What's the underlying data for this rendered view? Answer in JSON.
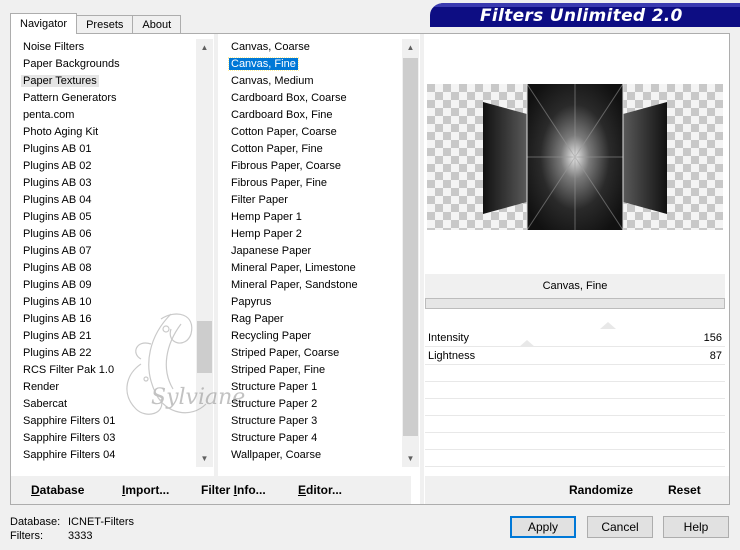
{
  "tabs": [
    "Navigator",
    "Presets",
    "About"
  ],
  "banner_title": "Filters Unlimited 2.0",
  "categories": [
    "Noise Filters",
    "Paper Backgrounds",
    "Paper Textures",
    "Pattern Generators",
    "penta.com",
    "Photo Aging Kit",
    "Plugins AB 01",
    "Plugins AB 02",
    "Plugins AB 03",
    "Plugins AB 04",
    "Plugins AB 05",
    "Plugins AB 06",
    "Plugins AB 07",
    "Plugins AB 08",
    "Plugins AB 09",
    "Plugins AB 10",
    "Plugins AB 16",
    "Plugins AB 21",
    "Plugins AB 22",
    "RCS Filter Pak 1.0",
    "Render",
    "Sabercat",
    "Sapphire Filters 01",
    "Sapphire Filters 03",
    "Sapphire Filters 04"
  ],
  "categories_selected_index": 2,
  "filters": [
    "Canvas, Coarse",
    "Canvas, Fine",
    "Canvas, Medium",
    "Cardboard Box, Coarse",
    "Cardboard Box, Fine",
    "Cotton Paper, Coarse",
    "Cotton Paper, Fine",
    "Fibrous Paper, Coarse",
    "Fibrous Paper, Fine",
    "Filter Paper",
    "Hemp Paper 1",
    "Hemp Paper 2",
    "Japanese Paper",
    "Mineral Paper, Limestone",
    "Mineral Paper, Sandstone",
    "Papyrus",
    "Rag Paper",
    "Recycling Paper",
    "Striped Paper, Coarse",
    "Striped Paper, Fine",
    "Structure Paper 1",
    "Structure Paper 2",
    "Structure Paper 3",
    "Structure Paper 4",
    "Wallpaper, Coarse"
  ],
  "filters_selected_index": 1,
  "current_filter": "Canvas, Fine",
  "parameters": [
    {
      "label": "Intensity",
      "value": "156",
      "fraction": 0.61
    },
    {
      "label": "Lightness",
      "value": "87",
      "fraction": 0.34
    }
  ],
  "bottom_buttons": {
    "database": {
      "u": "D",
      "rest": "atabase"
    },
    "import": {
      "u": "I",
      "rest": "mport..."
    },
    "filter_info": {
      "pre": "Filter ",
      "u": "I",
      "rest": "nfo..."
    },
    "editor": {
      "u": "E",
      "rest": "ditor..."
    },
    "randomize": "Randomize",
    "reset": "Reset"
  },
  "footer": {
    "database_label": "Database:",
    "database_value": "ICNET-Filters",
    "filters_label": "Filters:",
    "filters_value": "3333"
  },
  "actions": {
    "apply": "Apply",
    "cancel": "Cancel",
    "help": "Help"
  },
  "watermark_text": "Sylviane"
}
